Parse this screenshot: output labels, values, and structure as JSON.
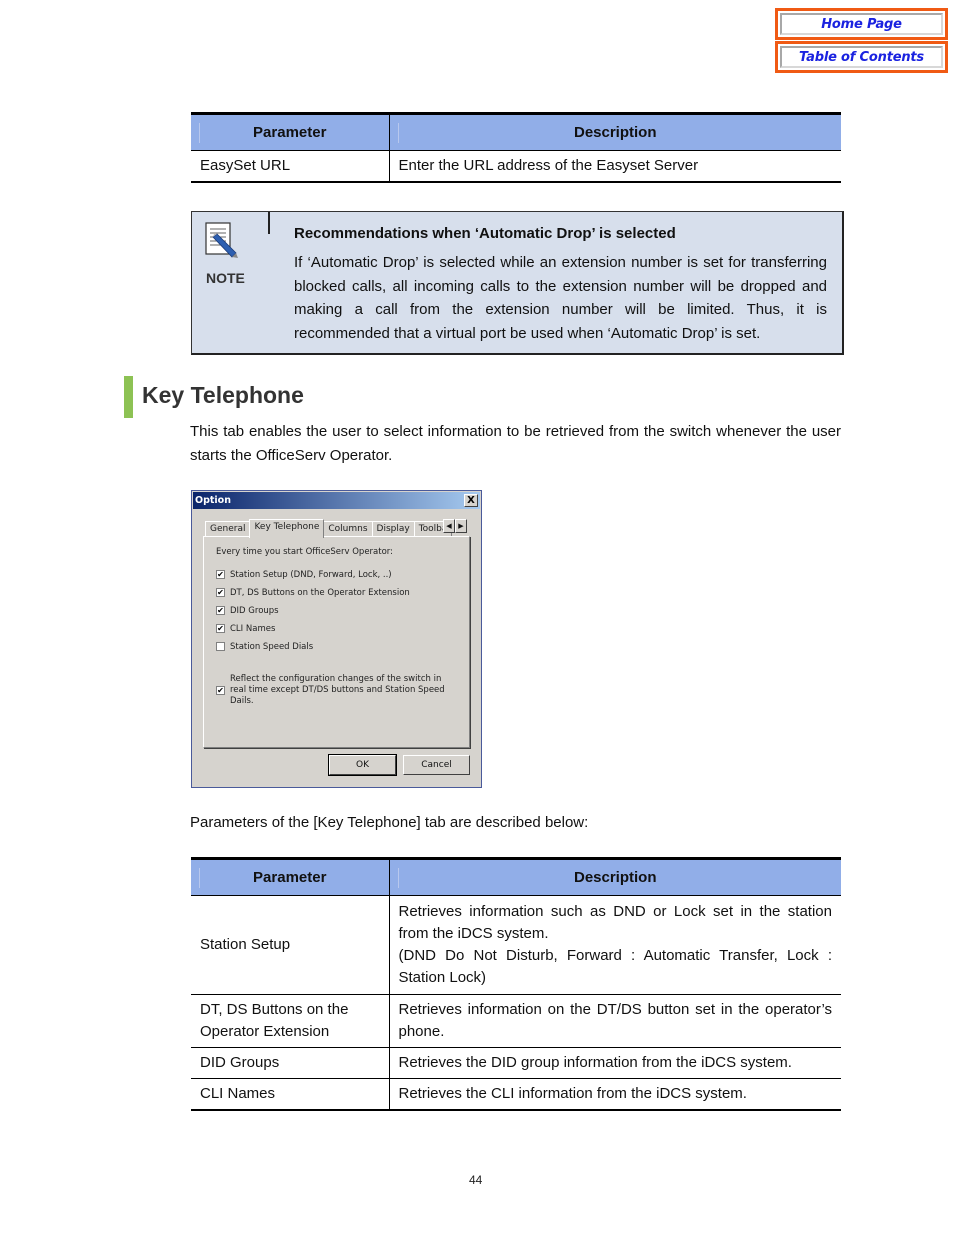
{
  "nav": {
    "home_label": "Home Page",
    "toc_label": "Table of Contents",
    "border_color": "#f05a14",
    "text_color": "#1a22e0"
  },
  "table1": {
    "headers": [
      "Parameter",
      "Description"
    ],
    "rows": [
      {
        "parameter": "EasySet URL",
        "description": "Enter the URL address of the Easyset Server"
      }
    ]
  },
  "note": {
    "icon": "note-pencil-icon",
    "label": "NOTE",
    "title": "Recommendations when ‘Automatic Drop’ is selected",
    "body": "If ‘Automatic Drop’ is selected while an extension number is set for transferring blocked calls, all incoming calls to the extension number will be dropped and making a call from the extension number will be limited. Thus, it is recommended that a virtual port be used when ‘Automatic Drop’ is set."
  },
  "section": {
    "title": "Key Telephone",
    "accent_color": "#8dc254",
    "intro": "This tab enables the user to select information to be retrieved from the switch whenever the user starts the OfficeServ Operator."
  },
  "dialog": {
    "title": "Option",
    "close_label": "X",
    "tabs": [
      "General",
      "Key Telephone",
      "Columns",
      "Display",
      "Toolba"
    ],
    "active_tab": "Key Telephone",
    "scroll_left": "◀",
    "scroll_right": "▶",
    "panel_heading": "Every time you start OfficeServ Operator:",
    "checkboxes": [
      {
        "label": "Station Setup (DND, Forward, Lock, ..)",
        "checked": true,
        "mark": "✔"
      },
      {
        "label": "DT, DS Buttons on the Operator Extension",
        "checked": true,
        "mark": "✔"
      },
      {
        "label": "DID Groups",
        "checked": true,
        "mark": "✔"
      },
      {
        "label": "CLI Names",
        "checked": true,
        "mark": "✔"
      },
      {
        "label": "Station Speed Dials",
        "checked": false,
        "mark": ""
      },
      {
        "label": "Reflect the configuration changes of the switch in real time except DT/DS buttons and Station Speed Dails.",
        "checked": true,
        "mark": "✔"
      }
    ],
    "ok_label": "OK",
    "cancel_label": "Cancel"
  },
  "params_intro": "Parameters of the [Key Telephone] tab are described below:",
  "table2": {
    "headers": [
      "Parameter",
      "Description"
    ],
    "rows": [
      {
        "parameter": "Station Setup",
        "description": "Retrieves information such as DND or Lock set in the station from the iDCS system.",
        "description_extra": "(DND Do Not Disturb, Forward : Automatic Transfer, Lock : Station Lock)"
      },
      {
        "parameter": "DT, DS Buttons on the Operator Extension",
        "description": "Retrieves information on the DT/DS button set in the operator’s phone."
      },
      {
        "parameter": "DID Groups",
        "description": "Retrieves the DID group information from the iDCS system."
      },
      {
        "parameter": "CLI Names",
        "description": "Retrieves the CLI information from the iDCS system."
      }
    ]
  },
  "page_number": "44"
}
